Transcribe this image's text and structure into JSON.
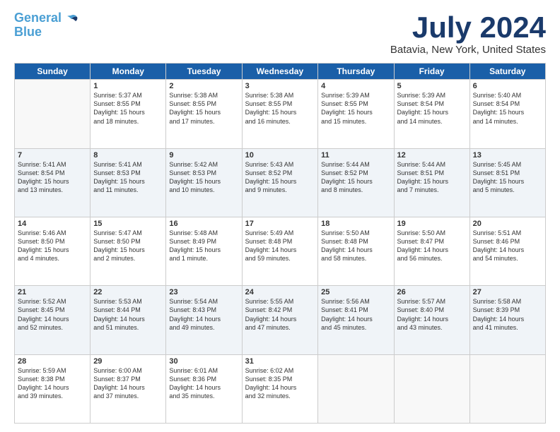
{
  "logo": {
    "line1": "General",
    "line2": "Blue"
  },
  "title": "July 2024",
  "subtitle": "Batavia, New York, United States",
  "days": [
    "Sunday",
    "Monday",
    "Tuesday",
    "Wednesday",
    "Thursday",
    "Friday",
    "Saturday"
  ],
  "weeks": [
    [
      {
        "num": "",
        "content": ""
      },
      {
        "num": "1",
        "content": "Sunrise: 5:37 AM\nSunset: 8:55 PM\nDaylight: 15 hours\nand 18 minutes."
      },
      {
        "num": "2",
        "content": "Sunrise: 5:38 AM\nSunset: 8:55 PM\nDaylight: 15 hours\nand 17 minutes."
      },
      {
        "num": "3",
        "content": "Sunrise: 5:38 AM\nSunset: 8:55 PM\nDaylight: 15 hours\nand 16 minutes."
      },
      {
        "num": "4",
        "content": "Sunrise: 5:39 AM\nSunset: 8:55 PM\nDaylight: 15 hours\nand 15 minutes."
      },
      {
        "num": "5",
        "content": "Sunrise: 5:39 AM\nSunset: 8:54 PM\nDaylight: 15 hours\nand 14 minutes."
      },
      {
        "num": "6",
        "content": "Sunrise: 5:40 AM\nSunset: 8:54 PM\nDaylight: 15 hours\nand 14 minutes."
      }
    ],
    [
      {
        "num": "7",
        "content": "Sunrise: 5:41 AM\nSunset: 8:54 PM\nDaylight: 15 hours\nand 13 minutes."
      },
      {
        "num": "8",
        "content": "Sunrise: 5:41 AM\nSunset: 8:53 PM\nDaylight: 15 hours\nand 11 minutes."
      },
      {
        "num": "9",
        "content": "Sunrise: 5:42 AM\nSunset: 8:53 PM\nDaylight: 15 hours\nand 10 minutes."
      },
      {
        "num": "10",
        "content": "Sunrise: 5:43 AM\nSunset: 8:52 PM\nDaylight: 15 hours\nand 9 minutes."
      },
      {
        "num": "11",
        "content": "Sunrise: 5:44 AM\nSunset: 8:52 PM\nDaylight: 15 hours\nand 8 minutes."
      },
      {
        "num": "12",
        "content": "Sunrise: 5:44 AM\nSunset: 8:51 PM\nDaylight: 15 hours\nand 7 minutes."
      },
      {
        "num": "13",
        "content": "Sunrise: 5:45 AM\nSunset: 8:51 PM\nDaylight: 15 hours\nand 5 minutes."
      }
    ],
    [
      {
        "num": "14",
        "content": "Sunrise: 5:46 AM\nSunset: 8:50 PM\nDaylight: 15 hours\nand 4 minutes."
      },
      {
        "num": "15",
        "content": "Sunrise: 5:47 AM\nSunset: 8:50 PM\nDaylight: 15 hours\nand 2 minutes."
      },
      {
        "num": "16",
        "content": "Sunrise: 5:48 AM\nSunset: 8:49 PM\nDaylight: 15 hours\nand 1 minute."
      },
      {
        "num": "17",
        "content": "Sunrise: 5:49 AM\nSunset: 8:48 PM\nDaylight: 14 hours\nand 59 minutes."
      },
      {
        "num": "18",
        "content": "Sunrise: 5:50 AM\nSunset: 8:48 PM\nDaylight: 14 hours\nand 58 minutes."
      },
      {
        "num": "19",
        "content": "Sunrise: 5:50 AM\nSunset: 8:47 PM\nDaylight: 14 hours\nand 56 minutes."
      },
      {
        "num": "20",
        "content": "Sunrise: 5:51 AM\nSunset: 8:46 PM\nDaylight: 14 hours\nand 54 minutes."
      }
    ],
    [
      {
        "num": "21",
        "content": "Sunrise: 5:52 AM\nSunset: 8:45 PM\nDaylight: 14 hours\nand 52 minutes."
      },
      {
        "num": "22",
        "content": "Sunrise: 5:53 AM\nSunset: 8:44 PM\nDaylight: 14 hours\nand 51 minutes."
      },
      {
        "num": "23",
        "content": "Sunrise: 5:54 AM\nSunset: 8:43 PM\nDaylight: 14 hours\nand 49 minutes."
      },
      {
        "num": "24",
        "content": "Sunrise: 5:55 AM\nSunset: 8:42 PM\nDaylight: 14 hours\nand 47 minutes."
      },
      {
        "num": "25",
        "content": "Sunrise: 5:56 AM\nSunset: 8:41 PM\nDaylight: 14 hours\nand 45 minutes."
      },
      {
        "num": "26",
        "content": "Sunrise: 5:57 AM\nSunset: 8:40 PM\nDaylight: 14 hours\nand 43 minutes."
      },
      {
        "num": "27",
        "content": "Sunrise: 5:58 AM\nSunset: 8:39 PM\nDaylight: 14 hours\nand 41 minutes."
      }
    ],
    [
      {
        "num": "28",
        "content": "Sunrise: 5:59 AM\nSunset: 8:38 PM\nDaylight: 14 hours\nand 39 minutes."
      },
      {
        "num": "29",
        "content": "Sunrise: 6:00 AM\nSunset: 8:37 PM\nDaylight: 14 hours\nand 37 minutes."
      },
      {
        "num": "30",
        "content": "Sunrise: 6:01 AM\nSunset: 8:36 PM\nDaylight: 14 hours\nand 35 minutes."
      },
      {
        "num": "31",
        "content": "Sunrise: 6:02 AM\nSunset: 8:35 PM\nDaylight: 14 hours\nand 32 minutes."
      },
      {
        "num": "",
        "content": ""
      },
      {
        "num": "",
        "content": ""
      },
      {
        "num": "",
        "content": ""
      }
    ]
  ]
}
